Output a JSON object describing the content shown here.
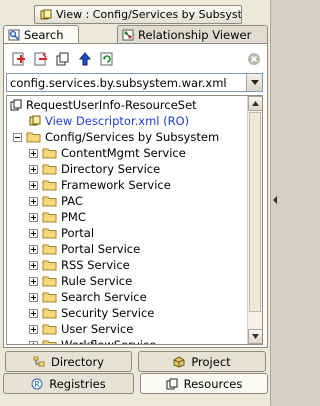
{
  "view_title": "View : Config/Services by Subsystem",
  "tabs": [
    {
      "label": "Search",
      "icon": "search-icon",
      "active": true
    },
    {
      "label": "Relationship Viewer",
      "icon": "relationship-icon",
      "active": false
    }
  ],
  "toolbar": {
    "buttons": [
      "add-icon",
      "remove-icon",
      "copy-icon",
      "move-up-icon",
      "refresh-icon",
      "stop-icon"
    ]
  },
  "selector": {
    "value": "config.services.by.subsystem.war.xml"
  },
  "tree": {
    "root": "RequestUserInfo-ResourceSet",
    "descriptor": "View Descriptor.xml (RO)",
    "folder": "Config/Services by Subsystem",
    "items": [
      "ContentMgmt Service",
      "Directory Service",
      "Framework Service",
      "PAC",
      "PMC",
      "Portal",
      "Portal Service",
      "RSS Service",
      "Rule Service",
      "Search Service",
      "Security Service",
      "User Service",
      "WorkflowService"
    ]
  },
  "bottom_tabs": [
    {
      "label": "Directory",
      "icon": "directory-icon",
      "active": false
    },
    {
      "label": "Project",
      "icon": "project-icon",
      "active": false
    },
    {
      "label": "Registries",
      "icon": "registries-icon",
      "active": false
    },
    {
      "label": "Resources",
      "icon": "resources-icon",
      "active": true
    }
  ],
  "colors": {
    "link": "#1f3fd6",
    "folder": "#f3d77a",
    "panel": "#ece9d8"
  }
}
